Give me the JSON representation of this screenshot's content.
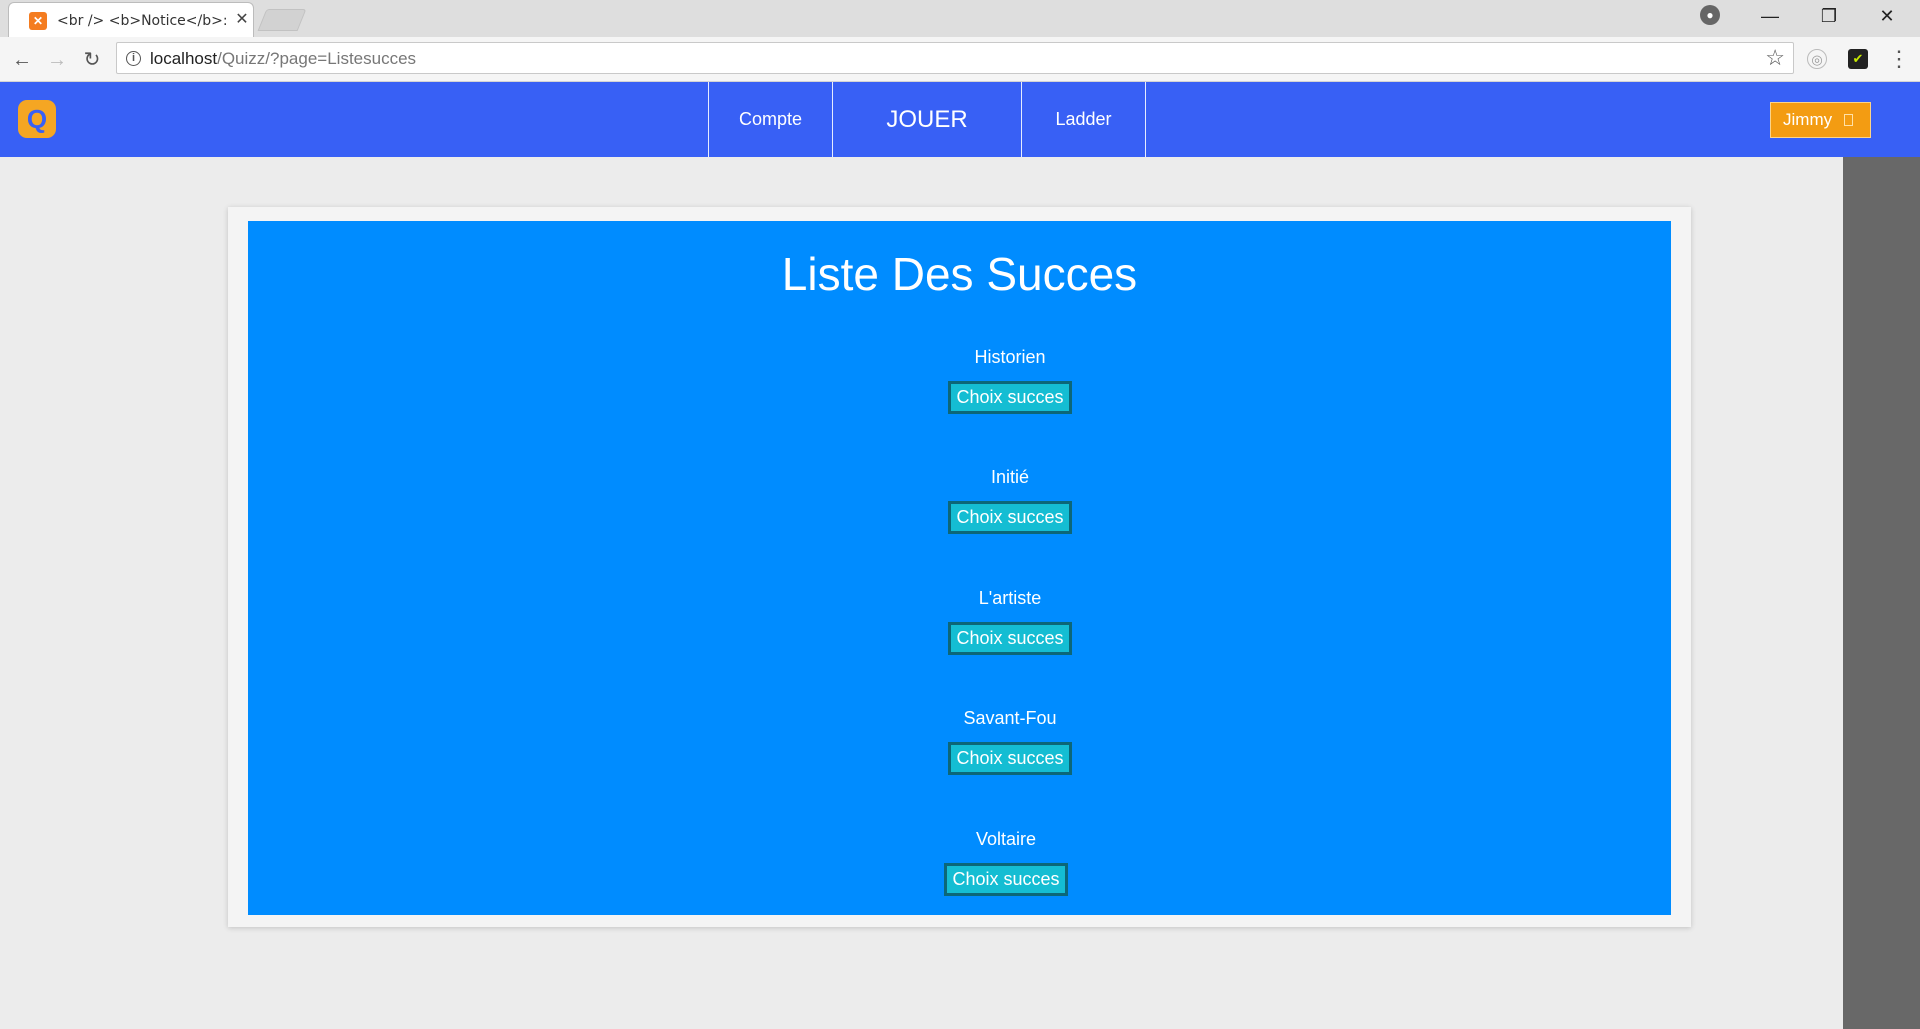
{
  "browser": {
    "tab_title": "<br /> <b>Notice</b>:",
    "url_host": "localhost",
    "url_path": "/Quizz/?page=Listesucces"
  },
  "navbar": {
    "items": [
      {
        "label": "Compte"
      },
      {
        "label": "JOUER"
      },
      {
        "label": "Ladder"
      }
    ],
    "user_label": "Jimmy"
  },
  "main": {
    "title": "Liste Des Succes",
    "achievements": [
      {
        "name": "Historien",
        "button_label": "Choix succes"
      },
      {
        "name": "Initié",
        "button_label": "Choix succes"
      },
      {
        "name": "L'artiste",
        "button_label": "Choix succes"
      },
      {
        "name": "Savant-Fou",
        "button_label": "Choix succes"
      },
      {
        "name": "Voltaire",
        "button_label": "Choix succes"
      }
    ]
  },
  "colors": {
    "navbar": "#3860f5",
    "panel": "#008cff",
    "button": "#14bdd3",
    "user_button": "#f39c12"
  }
}
